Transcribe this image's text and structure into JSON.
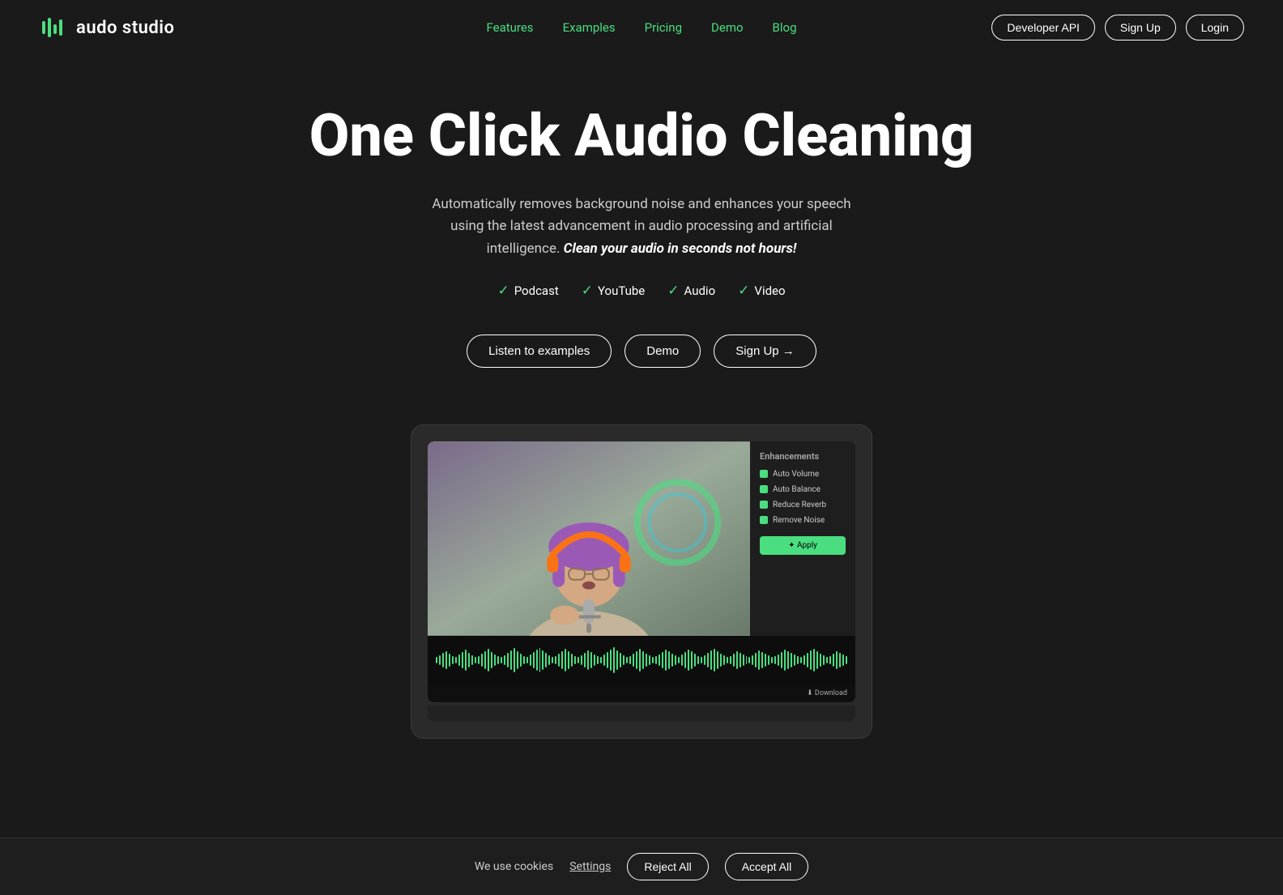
{
  "nav": {
    "logo_text": "audo studio",
    "links": [
      {
        "id": "features",
        "label": "Features"
      },
      {
        "id": "examples",
        "label": "Examples"
      },
      {
        "id": "pricing",
        "label": "Pricing"
      },
      {
        "id": "demo",
        "label": "Demo"
      },
      {
        "id": "blog",
        "label": "Blog"
      }
    ],
    "dev_api_label": "Developer API",
    "signup_label": "Sign Up",
    "login_label": "Login"
  },
  "hero": {
    "title": "One Click Audio Cleaning",
    "subtitle_plain": "Automatically removes background noise and enhances your speech using the latest advancement in audio processing and artificial intelligence.",
    "subtitle_bold": "Clean your audio in seconds not hours!",
    "badges": [
      {
        "id": "podcast",
        "label": "Podcast"
      },
      {
        "id": "youtube",
        "label": "YouTube"
      },
      {
        "id": "audio",
        "label": "Audio"
      },
      {
        "id": "video",
        "label": "Video"
      }
    ],
    "btn_listen": "Listen to examples",
    "btn_demo": "Demo",
    "btn_signup": "Sign Up →"
  },
  "enhancements": {
    "title": "Enhancements",
    "items": [
      {
        "id": "auto-volume",
        "label": "Auto Volume"
      },
      {
        "id": "auto-balance",
        "label": "Auto Balance"
      },
      {
        "id": "reduce-reverb",
        "label": "Reduce Reverb"
      },
      {
        "id": "remove-noise",
        "label": "Remove Noise"
      }
    ],
    "apply_label": "✦ Apply"
  },
  "download": {
    "label": "⬇ Download"
  },
  "cookie": {
    "text": "We use cookies",
    "settings_label": "Settings",
    "reject_label": "Reject All",
    "accept_label": "Accept All"
  }
}
